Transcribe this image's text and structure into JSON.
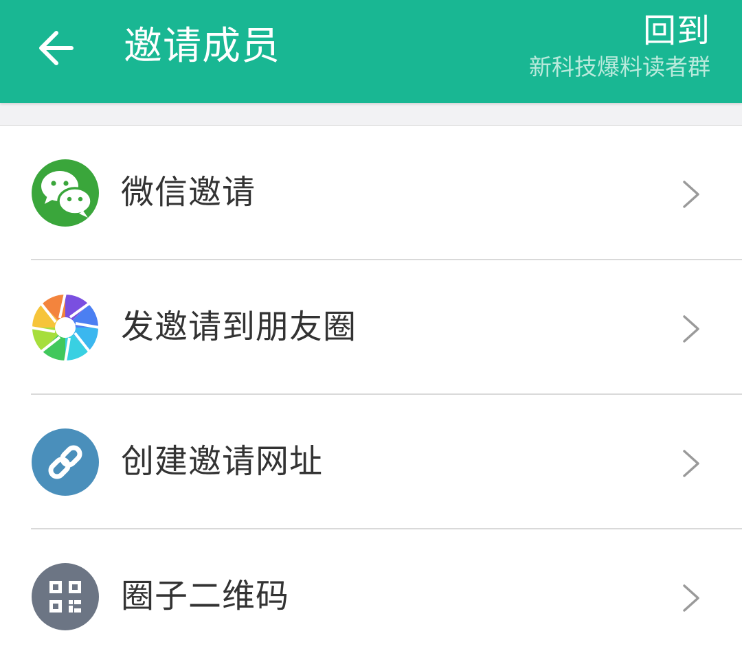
{
  "header": {
    "title": "邀请成员",
    "back_icon": "arrow-left-icon",
    "return_link": {
      "main": "回到",
      "sub": "新科技爆料读者群"
    },
    "background_color": "#19b793"
  },
  "menu": {
    "items": [
      {
        "label": "微信邀请",
        "icon": "wechat-icon",
        "icon_color": "#3aa63b"
      },
      {
        "label": "发邀请到朋友圈",
        "icon": "moments-aperture-icon"
      },
      {
        "label": "创建邀请网址",
        "icon": "link-icon",
        "icon_color": "#4a8fbb"
      },
      {
        "label": "圈子二维码",
        "icon": "qr-code-icon",
        "icon_color": "#6c7584"
      }
    ],
    "chevron_icon": "chevron-right-icon"
  }
}
